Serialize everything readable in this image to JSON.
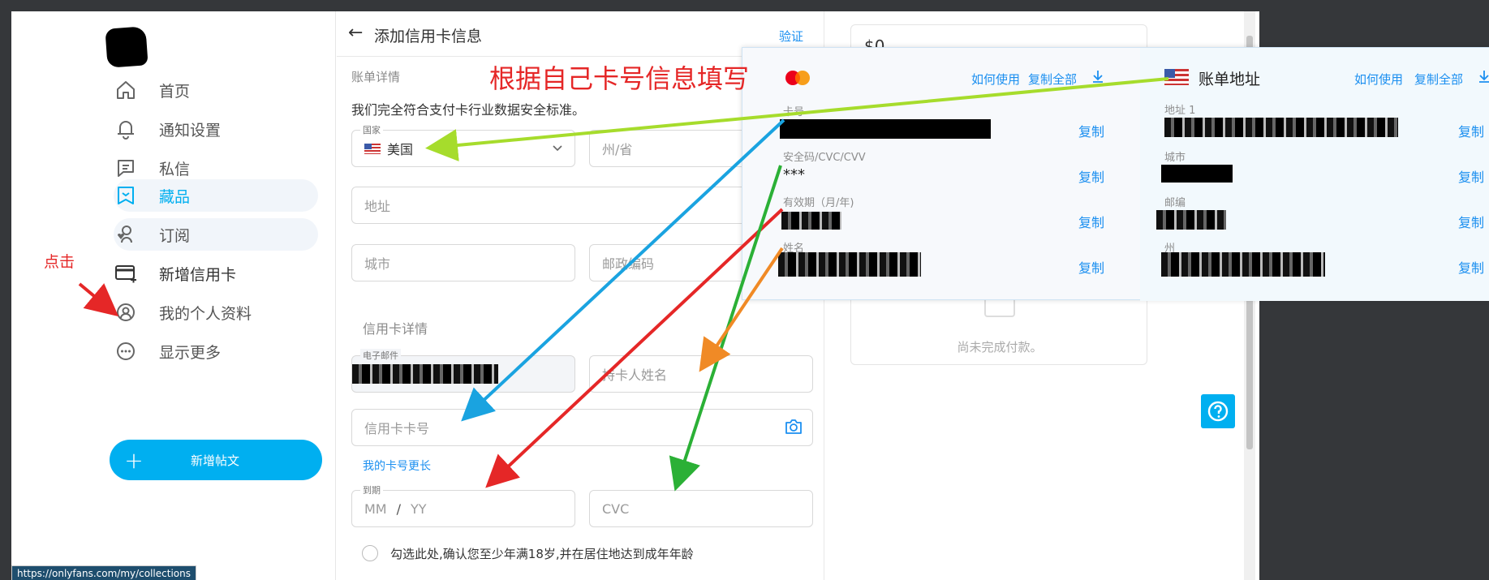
{
  "sidebar": {
    "items": [
      {
        "label": "首页",
        "icon": "home-icon"
      },
      {
        "label": "通知设置",
        "icon": "bell-icon"
      },
      {
        "label": "私信",
        "icon": "message-icon"
      },
      {
        "label": "藏品",
        "icon": "collections-icon"
      },
      {
        "label": "订阅",
        "icon": "subscriptions-icon"
      },
      {
        "label": "新增信用卡",
        "icon": "add-card-icon"
      },
      {
        "label": "我的个人资料",
        "icon": "profile-icon"
      },
      {
        "label": "显示更多",
        "icon": "more-icon"
      }
    ],
    "new_post_label": "新增帖文",
    "url_tip": "https://onlyfans.com/my/collections"
  },
  "form": {
    "title": "添加信用卡信息",
    "verify_link": "验证",
    "billing_section": "账单详情",
    "pci_notice": "我们完全符合支付卡行业数据安全标准。",
    "country_label": "国家",
    "country_value": "美国",
    "state_placeholder": "州/省",
    "address_placeholder": "地址",
    "city_placeholder": "城市",
    "zip_placeholder": "邮政编码",
    "card_section": "信用卡详情",
    "email_label": "电子邮件",
    "cardholder_placeholder": "持卡人姓名",
    "card_number_placeholder": "信用卡卡号",
    "longer_card_link": "我的卡号更长",
    "expiry_label": "到期",
    "expiry_mm": "MM",
    "expiry_sep": "/",
    "expiry_yy": "YY",
    "cvc_placeholder": "CVC",
    "age_confirm": "勾选此处,确认您至少年满18岁,并在居住地达到成年年龄"
  },
  "summary": {
    "amount": "$0",
    "status": "尚未完成付款。"
  },
  "popup": {
    "left": {
      "how_to_use": "如何使用",
      "copy_all": "复制全部",
      "card_number_label": "卡号",
      "cvv_label": "安全码/CVC/CVV",
      "cvv_value": "***",
      "expiry_label": "有效期（月/年)",
      "name_label": "姓名",
      "copy": "复制"
    },
    "right": {
      "title": "账单地址",
      "how_to_use": "如何使用",
      "copy_all": "复制全部",
      "address_label": "地址 1",
      "city_label": "城市",
      "zip_label": "邮编",
      "state_label": "州",
      "copy": "复制"
    }
  },
  "annotations": {
    "fill_hint": "根据自己卡号信息填写",
    "click_hint": "点击"
  },
  "colors": {
    "accent": "#00aff0",
    "link": "#1b8ff0",
    "annotation_red": "#e52727",
    "arrow_lime": "#a6dc2c",
    "arrow_blue": "#1aa3e0",
    "arrow_green": "#2bb036",
    "arrow_orange": "#f08a26"
  }
}
